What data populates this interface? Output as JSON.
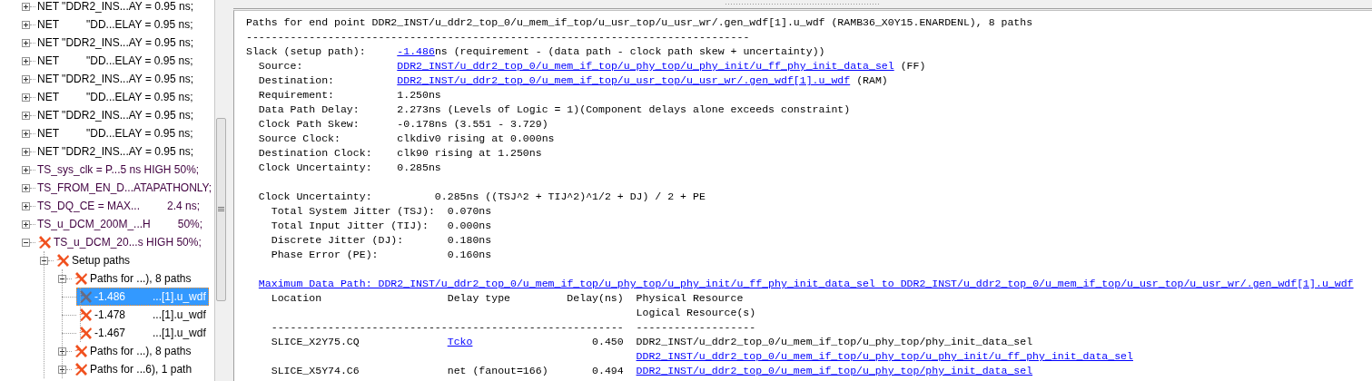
{
  "tree": {
    "items": [
      {
        "kind": "net",
        "parts": [
          "NET \"DDR2_INS...AY = 0.95 ns;"
        ],
        "expanded": false,
        "failed": false,
        "selected": false
      },
      {
        "kind": "net",
        "parts": [
          "NET",
          "\"DD...ELAY = 0.95 ns;"
        ],
        "expanded": false,
        "failed": false,
        "selected": false
      },
      {
        "kind": "net",
        "parts": [
          "NET \"DDR2_INS...AY = 0.95 ns;"
        ],
        "expanded": false,
        "failed": false,
        "selected": false
      },
      {
        "kind": "net",
        "parts": [
          "NET",
          "\"DD...ELAY = 0.95 ns;"
        ],
        "expanded": false,
        "failed": false,
        "selected": false
      },
      {
        "kind": "net",
        "parts": [
          "NET \"DDR2_INS...AY = 0.95 ns;"
        ],
        "expanded": false,
        "failed": false,
        "selected": false
      },
      {
        "kind": "net",
        "parts": [
          "NET",
          "\"DD...ELAY = 0.95 ns;"
        ],
        "expanded": false,
        "failed": false,
        "selected": false
      },
      {
        "kind": "net",
        "parts": [
          "NET \"DDR2_INS...AY = 0.95 ns;"
        ],
        "expanded": false,
        "failed": false,
        "selected": false
      },
      {
        "kind": "net",
        "parts": [
          "NET",
          "\"DD...ELAY = 0.95 ns;"
        ],
        "expanded": false,
        "failed": false,
        "selected": false
      },
      {
        "kind": "net",
        "parts": [
          "NET \"DDR2_INS...AY = 0.95 ns;"
        ],
        "expanded": false,
        "failed": false,
        "selected": false
      },
      {
        "kind": "constraint",
        "parts": [
          "TS_sys_clk = P...5 ns HIGH 50%;"
        ],
        "expanded": false,
        "failed": false,
        "selected": false
      },
      {
        "kind": "constraint",
        "parts": [
          "TS_FROM_EN_D...ATAPATHONLY;"
        ],
        "expanded": false,
        "failed": false,
        "selected": false
      },
      {
        "kind": "constraint",
        "parts": [
          "TS_DQ_CE = MAX...",
          "2.4 ns;"
        ],
        "expanded": false,
        "failed": false,
        "selected": false
      },
      {
        "kind": "constraint",
        "parts": [
          "TS_u_DCM_200M_...H",
          "50%;"
        ],
        "expanded": false,
        "failed": false,
        "selected": false
      },
      {
        "kind": "constraint",
        "parts": [
          "TS_u_DCM_20...s HIGH 50%;"
        ],
        "expanded": true,
        "failed": true,
        "selected": false,
        "children": [
          {
            "kind": "group",
            "parts": [
              "Setup paths"
            ],
            "expanded": true,
            "failed": true,
            "selected": false,
            "children": [
              {
                "kind": "group",
                "parts": [
                  "Paths for ...), 8 paths"
                ],
                "expanded": true,
                "failed": true,
                "selected": false,
                "children": [
                  {
                    "kind": "path",
                    "parts": [
                      "-1.486",
                      "...[1].u_wdf"
                    ],
                    "failed": true,
                    "selected": true
                  },
                  {
                    "kind": "path",
                    "parts": [
                      "-1.478",
                      "...[1].u_wdf"
                    ],
                    "failed": true,
                    "selected": false
                  },
                  {
                    "kind": "path",
                    "parts": [
                      "-1.467",
                      "...[1].u_wdf"
                    ],
                    "failed": true,
                    "selected": false
                  }
                ]
              },
              {
                "kind": "group",
                "parts": [
                  "Paths for ...), 8 paths"
                ],
                "expanded": false,
                "failed": true,
                "selected": false
              },
              {
                "kind": "group",
                "parts": [
                  "Paths for ...6), 1 path"
                ],
                "expanded": false,
                "failed": true,
                "selected": false
              }
            ]
          }
        ]
      }
    ]
  },
  "report": {
    "title": "Paths for end point DDR2_INST/u_ddr2_top_0/u_mem_if_top/u_usr_top/u_usr_wr/.gen_wdf[1].u_wdf (RAMB36_X0Y15.ENARDENL), 8 paths",
    "rule": "--------------------------------------------------------------------------------",
    "slack": {
      "label": "Slack (setup path):",
      "value": [
        {
          "text": "-1.486",
          "link": true
        },
        {
          "text": "ns (requirement - (data path - clock path skew + uncertainty))",
          "link": false
        }
      ]
    },
    "fields": [
      {
        "label": "Source:",
        "value": [
          {
            "text": "DDR2_INST/u_ddr2_top_0/u_mem_if_top/u_phy_top/u_phy_init/u_ff_phy_init_data_sel",
            "link": true
          },
          {
            "text": " (FF)",
            "link": false
          }
        ]
      },
      {
        "label": "Destination:",
        "value": [
          {
            "text": "DDR2_INST/u_ddr2_top_0/u_mem_if_top/u_usr_top/u_usr_wr/.gen_wdf[1].u_wdf",
            "link": true
          },
          {
            "text": " (RAM)",
            "link": false
          }
        ]
      },
      {
        "label": "Requirement:",
        "value": [
          {
            "text": "1.250ns",
            "link": false
          }
        ]
      },
      {
        "label": "Data Path Delay:",
        "value": [
          {
            "text": "2.273ns (Levels of Logic = 1)(Component delays alone exceeds constraint)",
            "link": false
          }
        ]
      },
      {
        "label": "Clock Path Skew:",
        "value": [
          {
            "text": "-0.178ns (3.551 - 3.729)",
            "link": false
          }
        ]
      },
      {
        "label": "Source Clock:",
        "value": [
          {
            "text": "clkdiv0 rising at 0.000ns",
            "link": false
          }
        ]
      },
      {
        "label": "Destination Clock:",
        "value": [
          {
            "text": "clk90 rising at 1.250ns",
            "link": false
          }
        ]
      },
      {
        "label": "Clock Uncertainty:",
        "value": [
          {
            "text": "0.285ns",
            "link": false
          }
        ]
      }
    ],
    "uncertainty": {
      "label": "Clock Uncertainty:",
      "value": "0.285ns",
      "formula": "((TSJ^2 + TIJ^2)^1/2 + DJ) / 2 + PE",
      "components": [
        {
          "label": "Total System Jitter (TSJ):",
          "value": "0.070ns"
        },
        {
          "label": "Total Input Jitter (TIJ):",
          "value": "0.000ns"
        },
        {
          "label": "Discrete Jitter (DJ):",
          "value": "0.180ns"
        },
        {
          "label": "Phase Error (PE):",
          "value": "0.160ns"
        }
      ]
    },
    "data_path": {
      "title": "Maximum Data Path: DDR2_INST/u_ddr2_top_0/u_mem_if_top/u_phy_top/u_phy_init/u_ff_phy_init_data_sel to DDR2_INST/u_ddr2_top_0/u_mem_if_top/u_usr_top/u_usr_wr/.gen_wdf[1].u_wdf",
      "columns": [
        "Location",
        "Delay type",
        "Delay(ns)",
        "Physical Resource"
      ],
      "column_4_line_2": "Logical Resource(s)",
      "rules": [
        "--------------------------------------------------------",
        "-------------------"
      ],
      "rows": [
        {
          "location": "SLICE_X2Y75.CQ",
          "delay_type": {
            "text": "Tcko",
            "link": true
          },
          "delay": "0.450",
          "resources": [
            {
              "text": "DDR2_INST/u_ddr2_top_0/u_mem_if_top/u_phy_top/phy_init_data_sel",
              "link": false
            },
            {
              "text": "DDR2_INST/u_ddr2_top_0/u_mem_if_top/u_phy_top/u_phy_init/u_ff_phy_init_data_sel",
              "link": true
            }
          ]
        },
        {
          "location": "SLICE_X5Y74.C6",
          "delay_type": {
            "text": "net (fanout=166)",
            "link": false
          },
          "delay": "0.494",
          "resources": [
            {
              "text": "DDR2_INST/u_ddr2_top_0/u_mem_if_top/u_phy_top/phy_init_data_sel",
              "link": true
            }
          ]
        }
      ]
    }
  }
}
